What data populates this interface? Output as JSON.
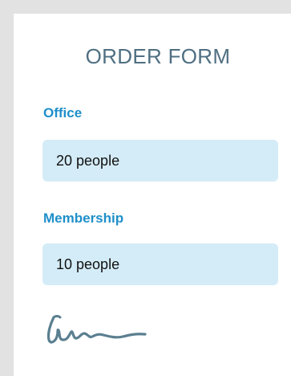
{
  "form": {
    "title": "ORDER FORM",
    "fields": [
      {
        "label": "Office",
        "value": "20 people"
      },
      {
        "label": "Membership",
        "value": "10 people"
      }
    ],
    "signature": "signature-graphic"
  },
  "colors": {
    "page_background": "#e2e2e2",
    "card_background": "#ffffff",
    "title": "#4f6f82",
    "label": "#1e8fca",
    "field_background": "#d4ecf7",
    "signature_ink": "#5a7f90"
  }
}
